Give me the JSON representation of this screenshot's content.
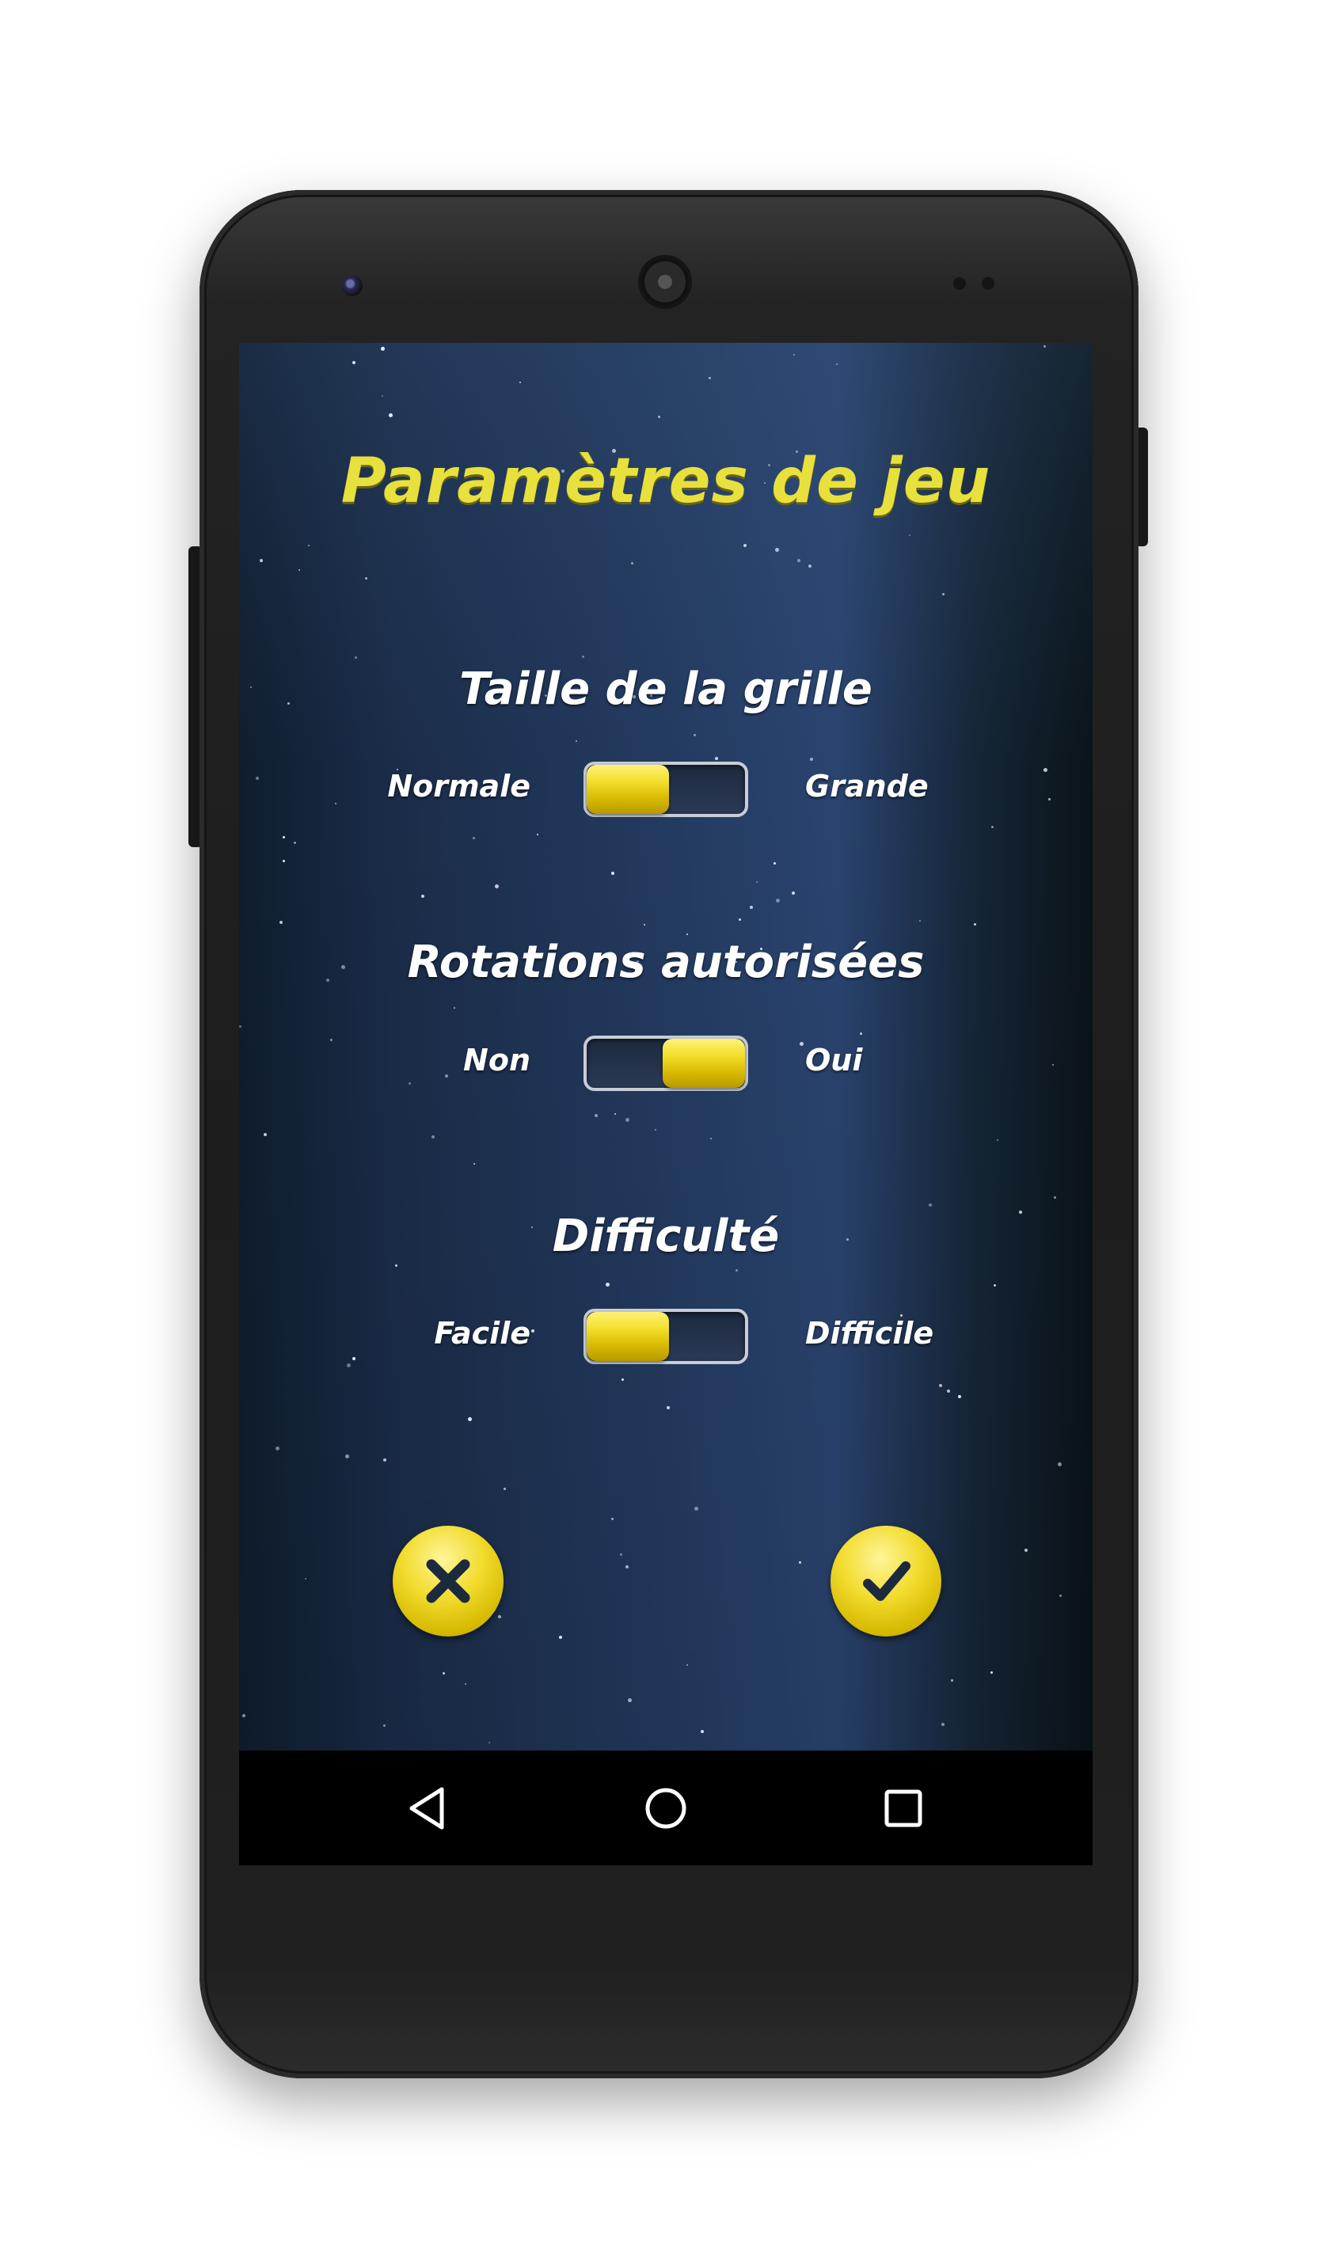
{
  "screen": {
    "title": "Paramètres de jeu",
    "settings": [
      {
        "label": "Taille de la grille",
        "option_left": "Normale",
        "option_right": "Grande",
        "selected": "left"
      },
      {
        "label": "Rotations autorisées",
        "option_left": "Non",
        "option_right": "Oui",
        "selected": "right"
      },
      {
        "label": "Difficulté",
        "option_left": "Facile",
        "option_right": "Difficile",
        "selected": "left"
      }
    ],
    "buttons": {
      "cancel_icon": "close-icon",
      "confirm_icon": "check-icon"
    }
  },
  "navbar": {
    "back_icon": "back-triangle-icon",
    "home_icon": "home-circle-icon",
    "recents_icon": "recents-square-icon"
  },
  "colors": {
    "accent": "#e8e03c",
    "button_yellow": "#f2dc2e",
    "icon_dark": "#1c2a3e",
    "text": "#ffffff"
  }
}
